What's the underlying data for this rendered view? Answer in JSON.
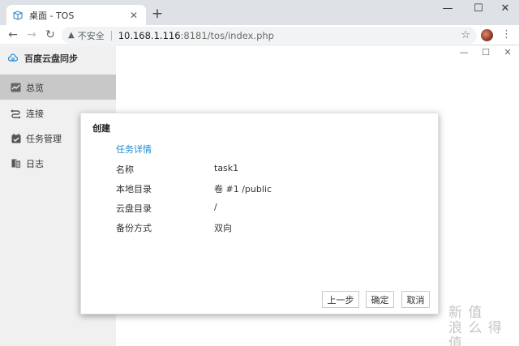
{
  "browser": {
    "tab_title": "桌面 - TOS",
    "tab_close": "✕",
    "new_tab": "+",
    "window_controls": {
      "minimize": "—",
      "maximize": "☐",
      "close": "✕"
    },
    "nav": {
      "back": "←",
      "forward": "→",
      "reload": "↻"
    },
    "security_icon": "▲",
    "security_label": "不安全",
    "url_host": "10.168.1.116",
    "url_rest": ":8181/tos/index.php",
    "bookmark": "☆",
    "menu": "⋮"
  },
  "app": {
    "title": "百度云盘同步",
    "window_controls": {
      "minimize": "—",
      "maximize": "☐",
      "close": "✕"
    },
    "sidebar": {
      "items": [
        {
          "label": "总览",
          "icon": "overview-chart-icon",
          "active": true
        },
        {
          "label": "连接",
          "icon": "connection-icon",
          "active": false
        },
        {
          "label": "任务管理",
          "icon": "task-check-icon",
          "active": false
        },
        {
          "label": "日志",
          "icon": "log-icon",
          "active": false
        }
      ]
    }
  },
  "dialog": {
    "title": "创建",
    "section": "任务详情",
    "rows": [
      {
        "label": "名称",
        "value": "task1"
      },
      {
        "label": "本地目录",
        "value": "卷 #1 /public"
      },
      {
        "label": "云盘目录",
        "value": "/"
      },
      {
        "label": "备份方式",
        "value": "双向"
      }
    ],
    "buttons": {
      "prev": "上一步",
      "ok": "确定",
      "cancel": "取消"
    }
  },
  "watermark": {
    "line1": "新 值",
    "line2": "浪 么 得 值"
  },
  "colors": {
    "accent": "#1a8bd4",
    "sidebar": "#f0f0f0",
    "sidebar_active": "#c8c8c8"
  }
}
